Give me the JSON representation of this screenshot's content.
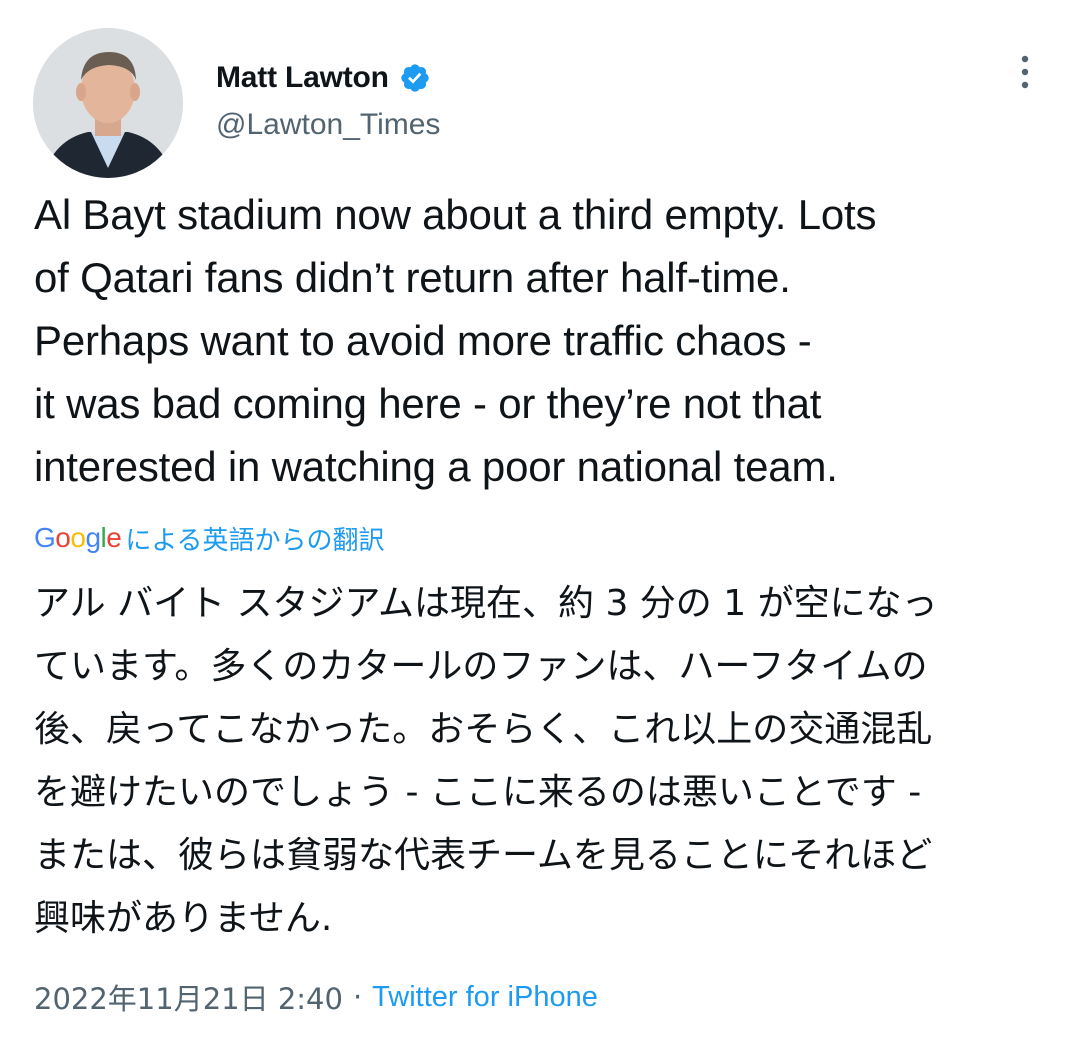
{
  "author": {
    "display_name": "Matt Lawton",
    "handle": "@Lawton_Times",
    "verified": true,
    "avatar": "avatar-photo"
  },
  "tweet": {
    "text": "Al Bayt stadium now about a third empty. Lots\nof Qatari fans didn’t return after half-time.\nPerhaps want to avoid more traffic chaos -\nit was bad coming here - or they’re not that\ninterested in watching a poor national team."
  },
  "translation": {
    "google_logo_letters": [
      "G",
      "o",
      "o",
      "g",
      "l",
      "e"
    ],
    "label": "による英語からの翻訳",
    "text": "アル バイト スタジアムは現在、約 3 分の 1 が空になっ\nています。多くのカタールのファンは、ハーフタイムの\n後、戻ってこなかった。おそらく、これ以上の交通混乱\nを避けたいのでしょう - ここに来るのは悪いことです -\nまたは、彼らは貧弱な代表チームを見ることにそれほど\n興味がありません."
  },
  "meta": {
    "timestamp": "2022年11月21日 2:40",
    "separator": "·",
    "source": "Twitter for iPhone"
  },
  "icons": {
    "verified": "verified-badge-icon",
    "more": "more-options-icon"
  },
  "colors": {
    "accent": "#1d9bf0",
    "text": "#0f1419",
    "secondary": "#536471",
    "google_blue": "#4285f4",
    "google_red": "#ea4335",
    "google_yellow": "#fbbc05",
    "google_green": "#34a853"
  }
}
